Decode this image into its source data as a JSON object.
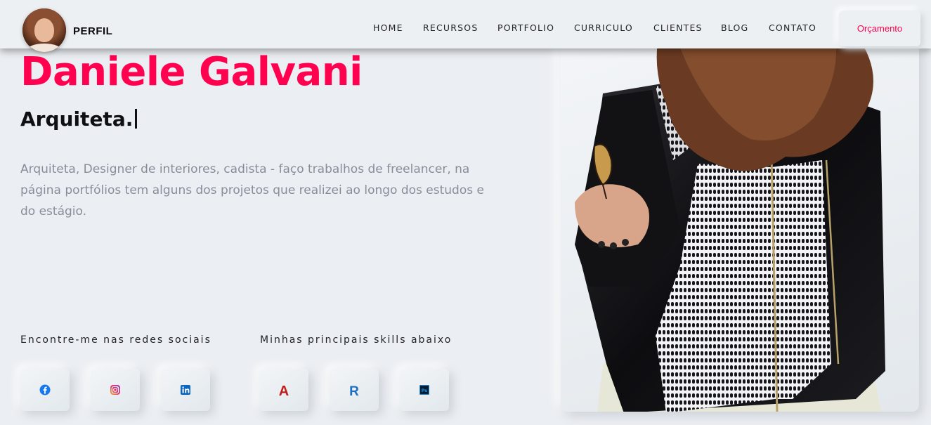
{
  "header": {
    "brand": "PERFIL",
    "nav": [
      {
        "label": "HOME"
      },
      {
        "label": "RECURSOS"
      },
      {
        "label": "PORTFOLIO"
      },
      {
        "label": "CURRICULO"
      },
      {
        "label": "CLIENTES"
      },
      {
        "label": "BLOG"
      },
      {
        "label": "CONTATO"
      }
    ],
    "cta_label": "Orçamento"
  },
  "hero": {
    "name": "Daniele Galvani",
    "role": "Arquiteta.",
    "description": "Arquiteta, Designer de interiores, cadista - faço trabalhos de freelancer, na página portfólios tem alguns dos projetos que realizei ao longo dos estudos e do estágio."
  },
  "social": {
    "title": "Encontre-me nas redes sociais",
    "items": [
      {
        "icon": "facebook-icon"
      },
      {
        "icon": "instagram-icon"
      },
      {
        "icon": "linkedin-icon"
      }
    ]
  },
  "skills": {
    "title": "Minhas principais skills abaixo",
    "items": [
      {
        "icon": "autocad-icon",
        "glyph": "A"
      },
      {
        "icon": "revit-icon",
        "glyph": "R"
      },
      {
        "icon": "photoshop-icon",
        "glyph": "Ps"
      }
    ]
  },
  "colors": {
    "accent": "#ff014f",
    "background": "#ebeef2",
    "text": "#1f2125",
    "muted_text": "#878e99"
  }
}
